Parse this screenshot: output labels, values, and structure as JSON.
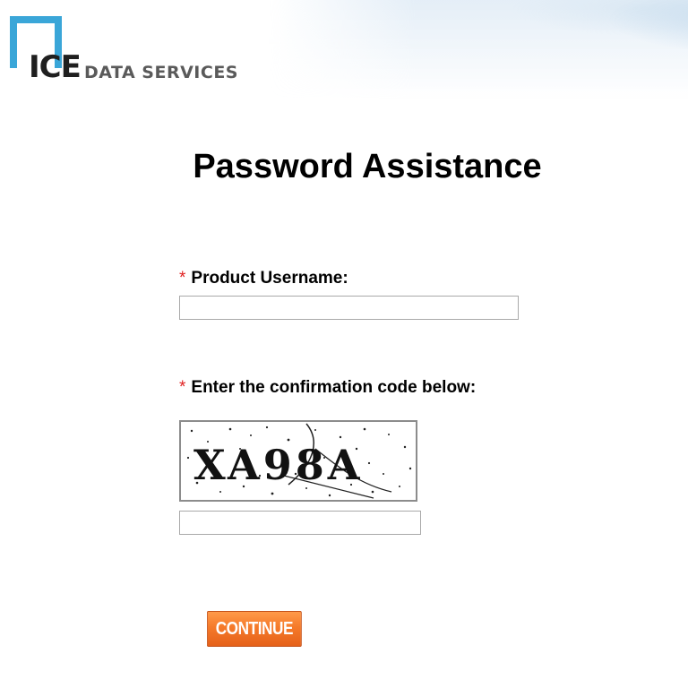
{
  "header": {
    "logo": {
      "brand": "ICE",
      "text": "DATA SERVICES",
      "accent_color": "#3aa6d8"
    }
  },
  "page_title": "Password Assistance",
  "form": {
    "username": {
      "required_marker": "*",
      "label": "Product Username:",
      "value": "",
      "placeholder": ""
    },
    "confirmation": {
      "required_marker": "*",
      "label": "Enter the confirmation code below:",
      "captcha_text": "XA98A",
      "value": "",
      "placeholder": ""
    },
    "submit_label": "CONTINUE"
  },
  "colors": {
    "required": "#e02020",
    "button": "#f57a2a",
    "logo_accent": "#3aa6d8"
  }
}
